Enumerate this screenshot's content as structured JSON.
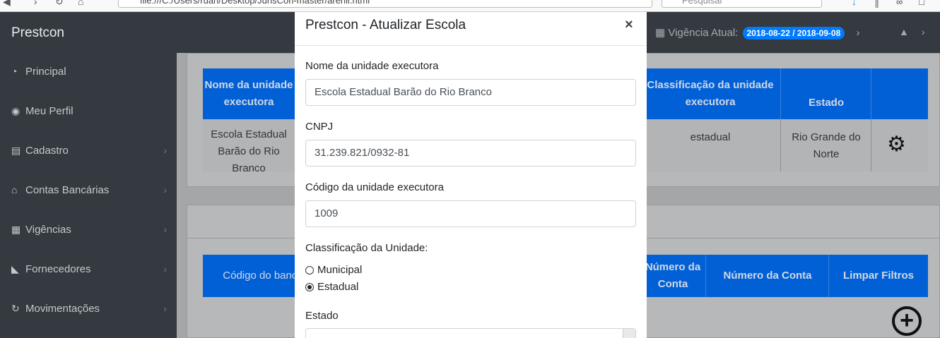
{
  "browser": {
    "url": "file:///C:/Users/ruan/Desktop/JunsCon-master/arenil.html",
    "search_placeholder": "Pesquisar"
  },
  "topnav": {
    "brand": "Prestcon",
    "vigencia_label": "Vigência Atual:",
    "vigencia_badge": "2018-08-22 / 2018-09-08"
  },
  "sidebar": {
    "items": [
      {
        "label": "Principal",
        "icon": "dashboard-icon",
        "has_arrow": false
      },
      {
        "label": "Meu Perfil",
        "icon": "user-circle-icon",
        "has_arrow": false
      },
      {
        "label": "Cadastro",
        "icon": "id-card-icon",
        "has_arrow": true
      },
      {
        "label": "Contas Bancárias",
        "icon": "bank-icon",
        "has_arrow": true
      },
      {
        "label": "Vigências",
        "icon": "calendar-icon",
        "has_arrow": true
      },
      {
        "label": "Fornecedores",
        "icon": "area-chart-icon",
        "has_arrow": true
      },
      {
        "label": "Movimentações",
        "icon": "refresh-icon",
        "has_arrow": true
      }
    ]
  },
  "table1": {
    "headers": [
      "Nome da unidade executora",
      "Classificação da unidade executora",
      "Estado",
      ""
    ],
    "row": {
      "nome": "Escola Estadual Barão do Rio Branco",
      "classificacao": "estadual",
      "estado": "Rio Grande do Norte"
    }
  },
  "table2": {
    "headers": [
      "Código do banco",
      "Número da Conta",
      "Número da Conta",
      "Limpar Filtros"
    ]
  },
  "modal": {
    "title": "Prestcon - Atualizar Escola",
    "close": "×",
    "nome_label": "Nome da unidade executora",
    "nome_value": "Escola Estadual Barão do Rio Branco",
    "cnpj_label": "CNPJ",
    "cnpj_value": "31.239.821/0932-81",
    "codigo_label": "Código da unidade executora",
    "codigo_value": "1009",
    "classificacao_label": "Classificação da Unidade:",
    "opt_municipal": "Municipal",
    "opt_estadual": "Estadual",
    "estado_label": "Estado"
  }
}
